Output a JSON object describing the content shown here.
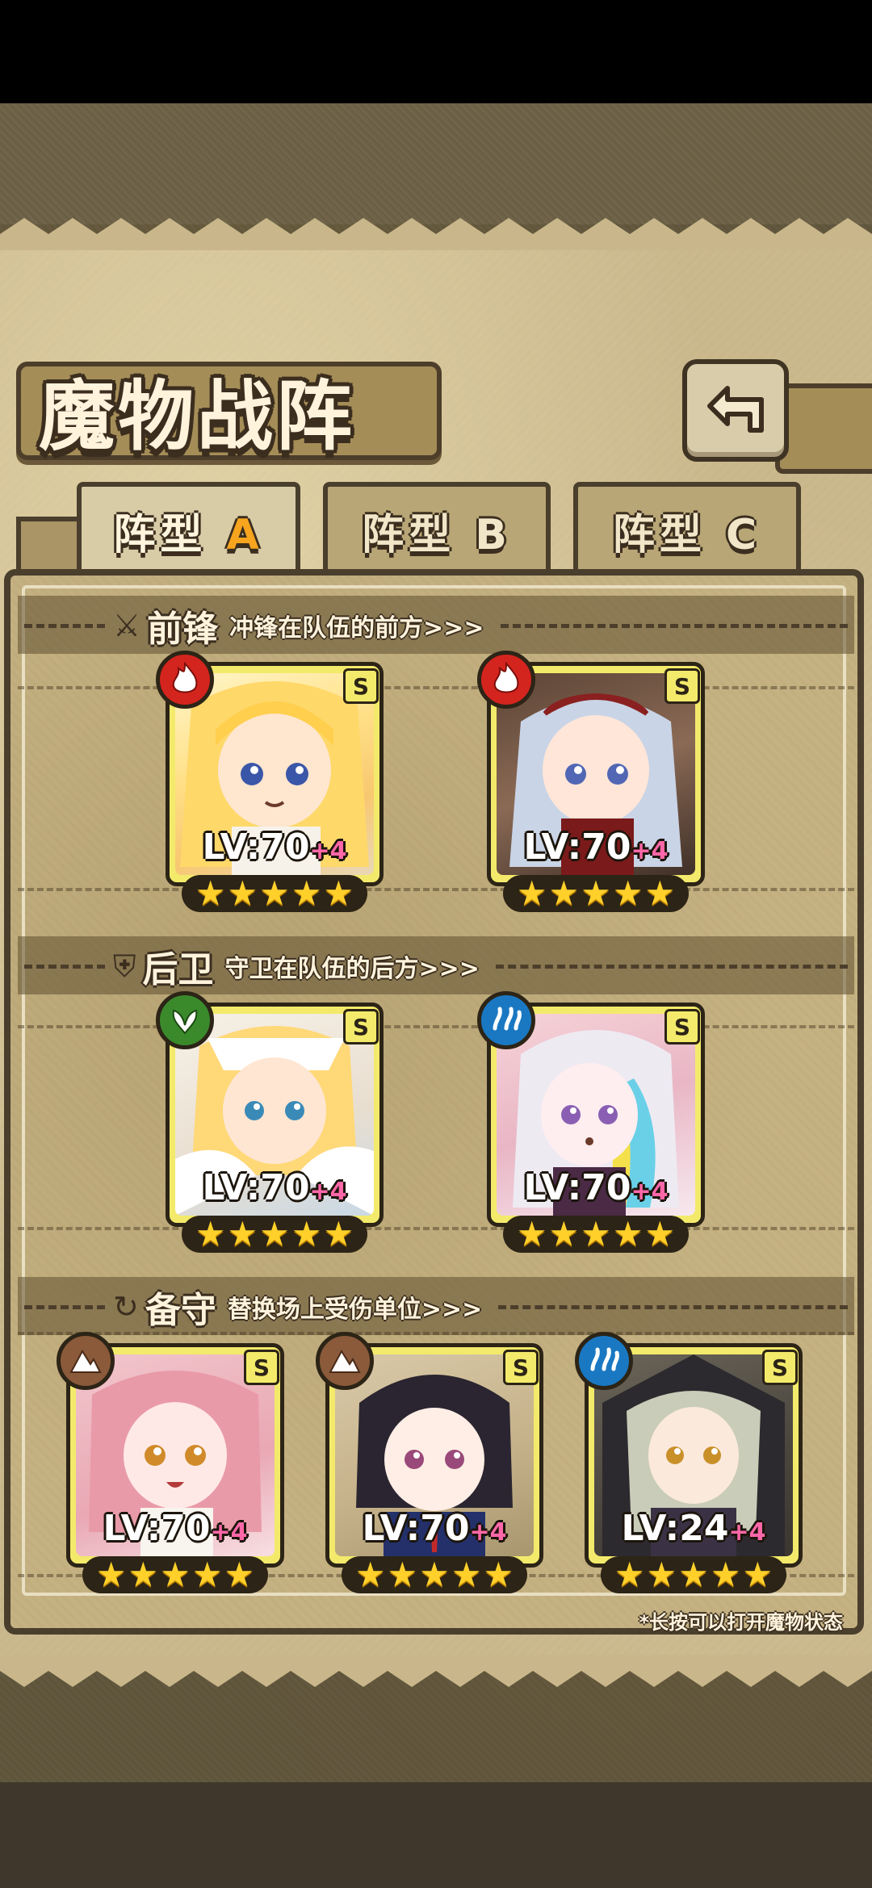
{
  "title": "魔物战阵",
  "tabs": [
    {
      "label": "阵型",
      "suffix": "A",
      "active": true
    },
    {
      "label": "阵型",
      "suffix": "B",
      "active": false
    },
    {
      "label": "阵型",
      "suffix": "C",
      "active": false
    }
  ],
  "sections": [
    {
      "title": "前锋",
      "desc": "冲锋在队伍的前方>>>",
      "icon": "sword-icon"
    },
    {
      "title": "后卫",
      "desc": "守卫在队伍的后方>>>",
      "icon": "shield-icon"
    },
    {
      "title": "备守",
      "desc": "替换场上受伤单位>>>",
      "icon": "swap-icon"
    }
  ],
  "monsters": [
    {
      "grade": "S",
      "level": "LV:70",
      "plus": "+4",
      "stars": 5,
      "element": "fire",
      "element_color": "#d4241e",
      "portrait": "blonde-girl"
    },
    {
      "grade": "S",
      "level": "LV:70",
      "plus": "+4",
      "stars": 5,
      "element": "fire",
      "element_color": "#d4241e",
      "portrait": "silver-maid"
    },
    {
      "grade": "S",
      "level": "LV:70",
      "plus": "+4",
      "stars": 5,
      "element": "wood",
      "element_color": "#3a8a2c",
      "portrait": "angel-girl"
    },
    {
      "grade": "S",
      "level": "LV:70",
      "plus": "+4",
      "stars": 5,
      "element": "water",
      "element_color": "#1a78c2",
      "portrait": "rainbow-girl"
    },
    {
      "grade": "S",
      "level": "LV:70",
      "plus": "+4",
      "stars": 5,
      "element": "earth",
      "element_color": "#8a5a3a",
      "portrait": "pink-girl"
    },
    {
      "grade": "S",
      "level": "LV:70",
      "plus": "+4",
      "stars": 5,
      "element": "earth",
      "element_color": "#8a5a3a",
      "portrait": "suit-girl"
    },
    {
      "grade": "S",
      "level": "LV:24",
      "plus": "+4",
      "stars": 5,
      "element": "water",
      "element_color": "#1a78c2",
      "portrait": "witch-girl"
    }
  ],
  "hint": "*长按可以打开魔物状态"
}
